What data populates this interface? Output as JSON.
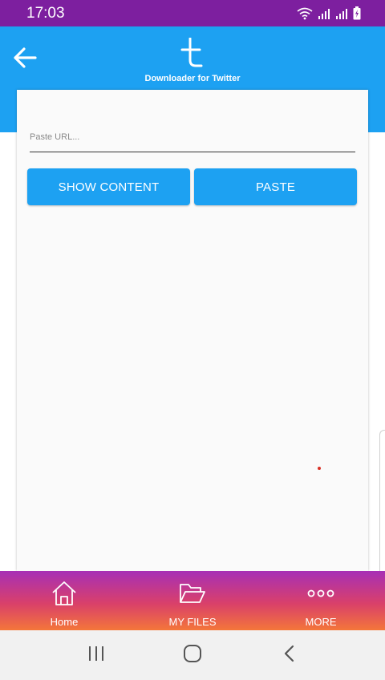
{
  "status_bar": {
    "time": "17:03",
    "icons": [
      "wifi-icon",
      "signal-icon",
      "signal-icon",
      "battery-charging-icon"
    ]
  },
  "header": {
    "back_icon": "arrow-left-icon",
    "logo_icon": "twitter-t-logo",
    "title": "Downloader for Twitter"
  },
  "form": {
    "url_placeholder": "Paste URL...",
    "url_value": "",
    "show_content_label": "SHOW CONTENT",
    "paste_label": "PASTE"
  },
  "bottom_nav": {
    "items": [
      {
        "label": "Home",
        "icon": "home-icon"
      },
      {
        "label": "MY FILES",
        "icon": "folder-open-icon"
      },
      {
        "label": "MORE",
        "icon": "more-dots-icon"
      }
    ]
  },
  "system_nav": {
    "buttons": [
      "recents-icon",
      "home-circle-icon",
      "back-chevron-icon"
    ]
  },
  "colors": {
    "status_bar": "#7d1f9f",
    "accent": "#1da1f2",
    "nav_gradient": [
      "#a72fb6",
      "#d9406a",
      "#f4763a"
    ],
    "card_bg": "#fafafa"
  }
}
